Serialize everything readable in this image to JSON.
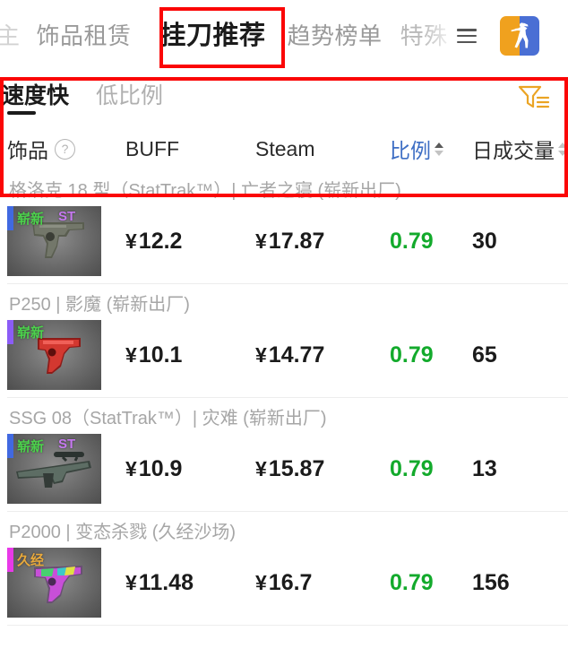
{
  "header": {
    "nav_items": [
      {
        "label": "主",
        "state": "cut-off"
      },
      {
        "label": "饰品租赁",
        "state": "normal"
      },
      {
        "label": "挂刀推荐",
        "state": "active"
      },
      {
        "label": "趋势榜单",
        "state": "normal"
      },
      {
        "label": "特殊",
        "state": "faded"
      }
    ],
    "menu_icon": "hamburger-icon",
    "logo_icon": "csgo-logo-icon",
    "logo_colors": {
      "left": "#f0a11e",
      "right": "#4a6fd4"
    }
  },
  "filter_tabs": [
    {
      "label": "速度快",
      "active": true
    },
    {
      "label": "低比例",
      "active": false
    }
  ],
  "filter_button": {
    "icon": "funnel-filter-icon",
    "color": "#eba424"
  },
  "table": {
    "columns": [
      {
        "key": "item",
        "label": "饰品",
        "help": "?",
        "sortable": false,
        "active": false
      },
      {
        "key": "buff",
        "label": "BUFF",
        "sortable": false,
        "active": false
      },
      {
        "key": "steam",
        "label": "Steam",
        "sortable": false,
        "active": false
      },
      {
        "key": "ratio",
        "label": "比例",
        "sortable": true,
        "active": true
      },
      {
        "key": "vol",
        "label": "日成交量",
        "sortable": true,
        "active": false
      }
    ],
    "rows": [
      {
        "title": "格洛克 18 型（StatTrak™）| 亡者之寝 (崭新出厂)",
        "buff": "12.2",
        "steam": "17.87",
        "ratio": "0.79",
        "volume": "30",
        "thumb": {
          "rarity_color": "#4169e1",
          "wear_tag": "崭新",
          "wear_class": "new",
          "st_tag": "ST",
          "weapon": "glock-18",
          "weapon_colors": [
            "#4f5246",
            "#6b6f60",
            "#3a3c34"
          ]
        }
      },
      {
        "title": "P250 | 影魔 (崭新出厂)",
        "buff": "10.1",
        "steam": "14.77",
        "ratio": "0.79",
        "volume": "65",
        "thumb": {
          "rarity_color": "#8b5cf6",
          "wear_tag": "崭新",
          "wear_class": "new",
          "st_tag": "",
          "weapon": "p250",
          "weapon_colors": [
            "#b3221f",
            "#e03a32",
            "#6d120f"
          ]
        }
      },
      {
        "title": "SSG 08（StatTrak™）| 灾难 (崭新出厂)",
        "buff": "10.9",
        "steam": "15.87",
        "ratio": "0.79",
        "volume": "13",
        "thumb": {
          "rarity_color": "#4169e1",
          "wear_tag": "崭新",
          "wear_class": "new",
          "st_tag": "ST",
          "weapon": "ssg-08",
          "weapon_colors": [
            "#44514a",
            "#6d7d74",
            "#2c3430"
          ]
        }
      },
      {
        "title": "P2000 | 变态杀戮 (久经沙场)",
        "buff": "11.48",
        "steam": "16.7",
        "ratio": "0.79",
        "volume": "156",
        "thumb": {
          "rarity_color": "#e839e8",
          "wear_tag": "久经",
          "wear_class": "worn",
          "st_tag": "",
          "weapon": "p2000",
          "weapon_colors": [
            "#d24fd2",
            "#46c8c8",
            "#e6e64a"
          ]
        }
      }
    ],
    "currency_symbol": "¥",
    "ratio_color": "#13aa2c"
  },
  "annotations": [
    {
      "name": "tab-highlight",
      "color": "#fb0606",
      "targets": "挂刀推荐"
    },
    {
      "name": "filter-area-highlight",
      "color": "#fb0606",
      "targets": "filter tabs and column headers"
    }
  ]
}
